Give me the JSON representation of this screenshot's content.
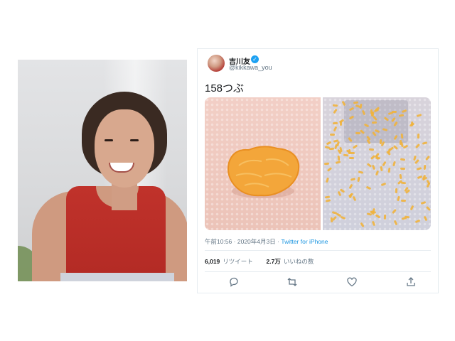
{
  "tweet": {
    "author_name": "吉川友",
    "handle": "@kikkawa_you",
    "text": "158つぶ",
    "time": "午前10:56",
    "date": "2020年4月3日",
    "separator": "·",
    "source": "Twitter for iPhone",
    "retweets_count": "6,019",
    "retweets_label": "リツイート",
    "likes_count": "2.7万",
    "likes_label": "いいねの数"
  },
  "icons": {
    "verified": "verified-badge-icon",
    "reply": "reply-icon",
    "retweet": "retweet-icon",
    "like": "heart-icon",
    "share": "share-icon"
  },
  "colors": {
    "accent": "#1da1f2",
    "link": "#1b95e0",
    "muted": "#657786",
    "dress": "#c0322b",
    "seed": "#efb23d"
  }
}
